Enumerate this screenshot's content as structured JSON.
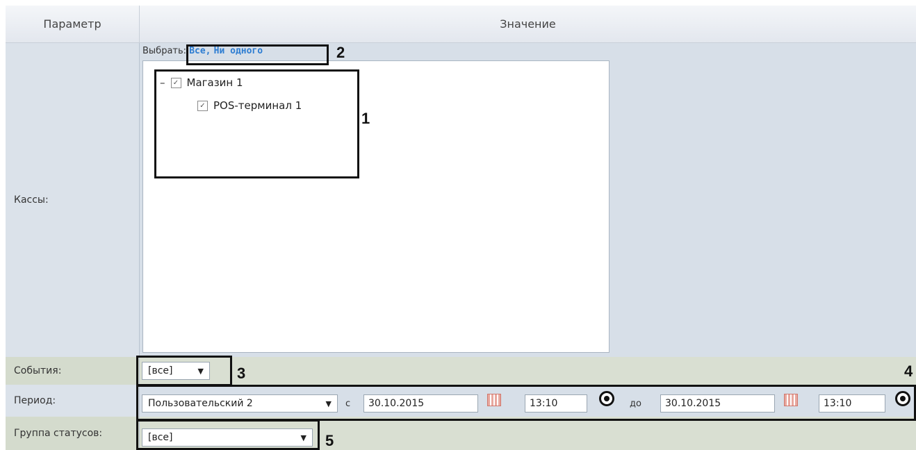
{
  "header": {
    "param": "Параметр",
    "value": "Значение"
  },
  "kassy": {
    "label": "Кассы:",
    "choose_prefix": "Выбрать:",
    "choose_all": "Все,",
    "choose_none": "Ни одного",
    "tree": [
      {
        "label": "Магазин 1",
        "checked": true,
        "expanded": true
      },
      {
        "label": "POS-терминал 1",
        "checked": true
      }
    ]
  },
  "events": {
    "label": "События:",
    "value": "[все]"
  },
  "period": {
    "label": "Период:",
    "type": "Пользовательский 2",
    "from_label": "с",
    "from_date": "30.10.2015",
    "from_time": "13:10",
    "to_label": "до",
    "to_date": "30.10.2015",
    "to_time": "13:10"
  },
  "status_group": {
    "label": "Группа статусов:",
    "value": "[все]"
  },
  "callouts": [
    "1",
    "2",
    "3",
    "4",
    "5"
  ],
  "icons": {
    "calendar": "calendar-icon",
    "clock": "time-picker-icon",
    "checkbox": "checkbox-icon"
  },
  "colors": {
    "link": "#2d7dd2",
    "header_bg": "#e3e7ee",
    "row_blue": "#d7dfe8",
    "row_green": "#d9dfd2"
  }
}
